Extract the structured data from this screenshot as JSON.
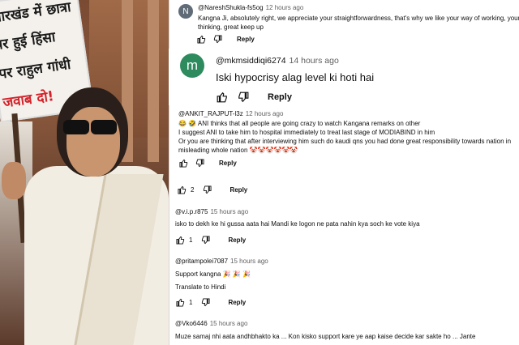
{
  "photo": {
    "sign_lines": [
      "झारखंड में छात्रा",
      "पर हुई हिंसा",
      "पर राहुल गांधी",
      "जवाब दो!"
    ]
  },
  "comments": [
    {
      "avatar_letter": "N",
      "handle": "@NareshShukla-fs5og",
      "time": "12 hours ago",
      "text": "Kangna Ji, absolutely right, we appreciate your straightforwardness, that's why we like your way of working, your way of",
      "text2": "thinking, great keep up",
      "likes": "",
      "reply": "Reply"
    },
    {
      "avatar_letter": "m",
      "handle": "@mkmsiddiqi6274",
      "time": "14 hours ago",
      "text": "Iski hypocrisy alag level ki hoti hai",
      "likes": "",
      "reply": "Reply"
    },
    {
      "handle": "@ANKIT_RAJPUT-l3z",
      "time": "12 hours ago",
      "line1": "😂 🤣  ANI thinks that all people are going crazy to watch Kangana remarks on other",
      "line2": "I suggest ANI to take him to hospital immediately to treat last stage of MODIABIND in him",
      "line3": "Or you are thinking that after interviewing him such do kaudi qns you had done great responsibility towards nation in",
      "line4": "misleading whole nation 🤡🤡🤡🤡🤡🤡",
      "likes": "",
      "reply": "Reply"
    },
    {
      "handle": "",
      "time": "",
      "text": "",
      "likes": "2",
      "reply": "Reply"
    },
    {
      "handle": "@v.i.p.r875",
      "time": "15 hours ago",
      "text": "isko to dekh ke hi gussa aata hai Mandi ke logon ne pata nahin kya soch ke vote kiya",
      "likes": "1",
      "reply": "Reply"
    },
    {
      "handle": "@pritampolei7087",
      "time": "15 hours ago",
      "text": "Support kangna 🎉 🎉 🎉",
      "translate": "Translate to Hindi",
      "likes": "1",
      "reply": "Reply"
    },
    {
      "handle": "@Vko6446",
      "time": "15 hours ago",
      "text": "Muze samaj nhi aata andhbhakto ka ... Kon kisko support kare ye aap kaise decide kar sakte ho ...  Jante"
    }
  ]
}
